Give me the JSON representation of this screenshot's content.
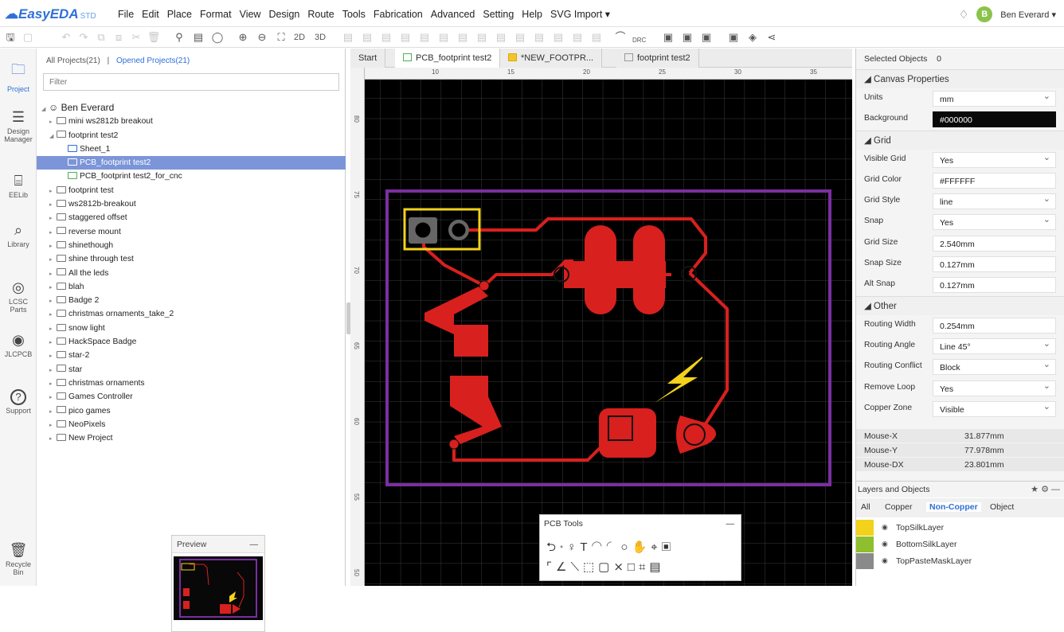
{
  "app": {
    "logo_text": "EasyEDA",
    "logo_suffix": "STD",
    "menu": [
      "File",
      "Edit",
      "Place",
      "Format",
      "View",
      "Design",
      "Route",
      "Tools",
      "Fabrication",
      "Advanced",
      "Setting",
      "Help",
      "SVG Import ▾"
    ],
    "user_initial": "B",
    "user_name": "Ben Everard ▾"
  },
  "toolbar": {
    "view_2d": "2D",
    "view_3d": "3D",
    "drc": "DRC"
  },
  "leftnav": [
    {
      "label": "Project",
      "icon": "folder-icon"
    },
    {
      "label": "Design Manager",
      "icon": "design-manager-icon"
    },
    {
      "label": "EELib",
      "icon": "component-icon"
    },
    {
      "label": "Library",
      "icon": "library-icon"
    },
    {
      "label": "LCSC Parts",
      "icon": "lcsc-icon"
    },
    {
      "label": "JLCPCB",
      "icon": "jlcpcb-icon"
    },
    {
      "label": "Support",
      "icon": "help-icon"
    },
    {
      "label": "Recycle Bin",
      "icon": "trash-icon"
    }
  ],
  "project_panel": {
    "tab_all": "All Projects(21)",
    "tab_sep": "|",
    "tab_opened": "Opened Projects(21)",
    "filter_placeholder": "Filter",
    "owner": "Ben Everard",
    "tree": [
      {
        "label": "mini ws2812b breakout",
        "level": 1,
        "type": "folder",
        "expanded": false
      },
      {
        "label": "footprint test2",
        "level": 1,
        "type": "folder",
        "expanded": true
      },
      {
        "label": "Sheet_1",
        "level": 2,
        "type": "schematic"
      },
      {
        "label": "PCB_footprint test2",
        "level": 2,
        "type": "pcb",
        "selected": true
      },
      {
        "label": "PCB_footprint test2_for_cnc",
        "level": 2,
        "type": "pcb"
      },
      {
        "label": "footprint test",
        "level": 1,
        "type": "folder"
      },
      {
        "label": "ws2812b-breakout",
        "level": 1,
        "type": "folder"
      },
      {
        "label": "staggered offset",
        "level": 1,
        "type": "folder"
      },
      {
        "label": "reverse mount",
        "level": 1,
        "type": "folder"
      },
      {
        "label": "shinethough",
        "level": 1,
        "type": "folder"
      },
      {
        "label": "shine through test",
        "level": 1,
        "type": "folder"
      },
      {
        "label": "All the leds",
        "level": 1,
        "type": "folder"
      },
      {
        "label": "blah",
        "level": 1,
        "type": "folder"
      },
      {
        "label": "Badge 2",
        "level": 1,
        "type": "folder"
      },
      {
        "label": "christmas ornaments_take_2",
        "level": 1,
        "type": "folder"
      },
      {
        "label": "snow light",
        "level": 1,
        "type": "folder"
      },
      {
        "label": "HackSpace Badge",
        "level": 1,
        "type": "folder"
      },
      {
        "label": "star-2",
        "level": 1,
        "type": "folder"
      },
      {
        "label": "star",
        "level": 1,
        "type": "folder"
      },
      {
        "label": "christmas ornaments",
        "level": 1,
        "type": "folder"
      },
      {
        "label": "Games Controller",
        "level": 1,
        "type": "folder"
      },
      {
        "label": "pico games",
        "level": 1,
        "type": "folder"
      },
      {
        "label": "NeoPixels",
        "level": 1,
        "type": "folder"
      },
      {
        "label": "New Project",
        "level": 1,
        "type": "folder"
      }
    ],
    "preview_title": "Preview",
    "minimize": "—"
  },
  "doc_tabs": [
    {
      "label": "Start",
      "active": false
    },
    {
      "label": "PCB_footprint test2",
      "active": true
    },
    {
      "label": "*NEW_FOOTPR...",
      "active": false
    },
    {
      "label": "footprint test2",
      "active": false
    }
  ],
  "ruler": {
    "h_ticks": [
      "10",
      "15",
      "20",
      "25",
      "30",
      "35"
    ],
    "v_ticks": [
      "80",
      "75",
      "70",
      "65",
      "60",
      "55",
      "50"
    ]
  },
  "pcb_tools": {
    "title": "PCB Tools",
    "minimize": "—",
    "row1": "⮌∘♀T◠◜○✋⌖▣",
    "row2": "⌜∠⟍⬚▢⨯□⌗▤"
  },
  "properties": {
    "selected_label": "Selected Objects",
    "selected_count": "0",
    "canvas_section": "Canvas Properties",
    "canvas_rows": [
      {
        "label": "Units",
        "value": "mm",
        "dropdown": true
      },
      {
        "label": "Background",
        "value": "#000000",
        "dropdown": false,
        "dark": true
      }
    ],
    "grid_section": "Grid",
    "grid_rows": [
      {
        "label": "Visible Grid",
        "value": "Yes",
        "dropdown": true
      },
      {
        "label": "Grid Color",
        "value": "#FFFFFF",
        "dropdown": false
      },
      {
        "label": "Grid Style",
        "value": "line",
        "dropdown": true
      },
      {
        "label": "Snap",
        "value": "Yes",
        "dropdown": true
      },
      {
        "label": "Grid Size",
        "value": "2.540mm",
        "dropdown": false
      },
      {
        "label": "Snap Size",
        "value": "0.127mm",
        "dropdown": false
      },
      {
        "label": "Alt Snap",
        "value": "0.127mm",
        "dropdown": false
      }
    ],
    "other_section": "Other",
    "other_rows": [
      {
        "label": "Routing Width",
        "value": "0.254mm",
        "dropdown": false
      },
      {
        "label": "Routing Angle",
        "value": "Line 45°",
        "dropdown": true
      },
      {
        "label": "Routing Conflict",
        "value": "Block",
        "dropdown": true
      },
      {
        "label": "Remove Loop",
        "value": "Yes",
        "dropdown": true
      },
      {
        "label": "Copper Zone",
        "value": "Visible",
        "dropdown": true
      }
    ],
    "mouse": [
      {
        "label": "Mouse-X",
        "value": "31.877mm"
      },
      {
        "label": "Mouse-Y",
        "value": "77.978mm"
      },
      {
        "label": "Mouse-DX",
        "value": "23.801mm"
      }
    ]
  },
  "layers": {
    "title": "Layers and Objects",
    "tabs": [
      "All",
      "Copper",
      "Non-Copper",
      "Object"
    ],
    "active_tab": "Non-Copper",
    "items": [
      {
        "name": "TopSilkLayer",
        "color": "#f2d21b"
      },
      {
        "name": "BottomSilkLayer",
        "color": "#8fbf2e"
      },
      {
        "name": "TopPasteMaskLayer",
        "color": "#8a8a8a"
      }
    ]
  },
  "colors": {
    "accent": "#2f6fd6",
    "copper": "#d8201e",
    "silk": "#f2d21b",
    "outline": "#7b2fa0",
    "canvas_bg": "#000000"
  }
}
